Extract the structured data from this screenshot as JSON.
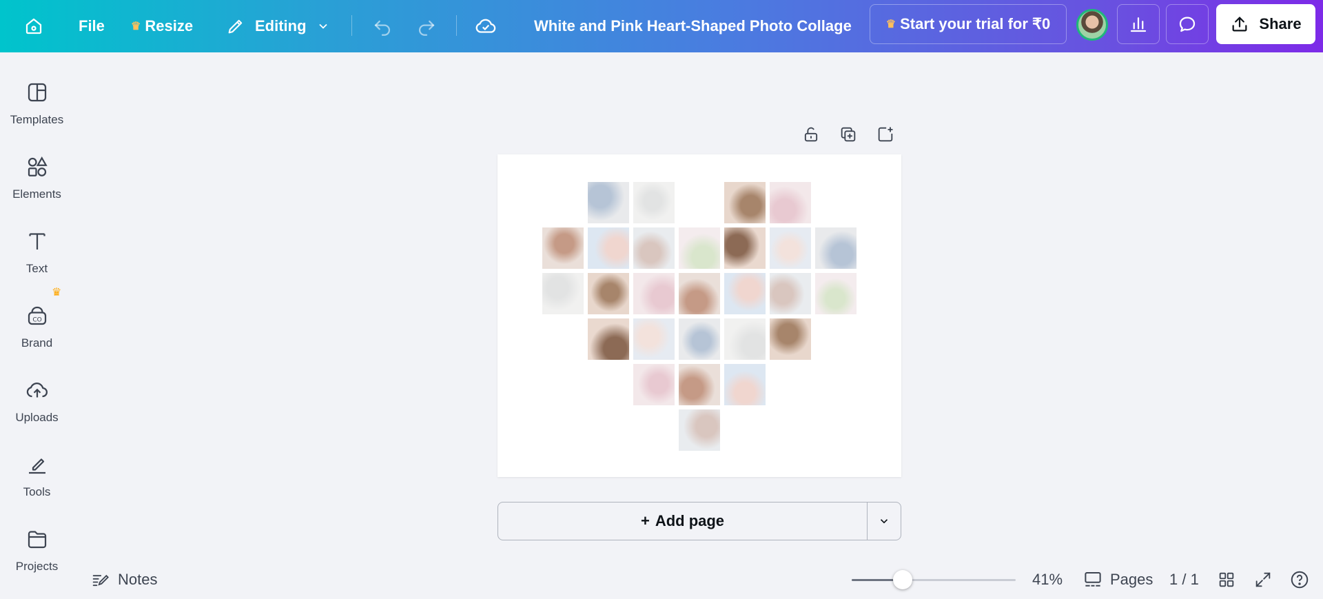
{
  "topbar": {
    "file_label": "File",
    "resize_label": "Resize",
    "editing_label": "Editing",
    "design_title": "White and Pink Heart-Shaped Photo Collage",
    "trial_label": "Start your trial for ₹0",
    "share_label": "Share",
    "crown_glyph": "♛"
  },
  "sidebar": {
    "items": [
      {
        "label": "Templates",
        "icon": "templates-icon"
      },
      {
        "label": "Elements",
        "icon": "elements-icon"
      },
      {
        "label": "Text",
        "icon": "text-icon"
      },
      {
        "label": "Brand",
        "icon": "brand-icon"
      },
      {
        "label": "Uploads",
        "icon": "uploads-icon"
      },
      {
        "label": "Tools",
        "icon": "tools-icon"
      },
      {
        "label": "Projects",
        "icon": "projects-icon"
      }
    ]
  },
  "canvas": {
    "add_page_label": "Add page",
    "add_page_plus": "+"
  },
  "bottom": {
    "notes_label": "Notes",
    "zoom_percent": 41,
    "zoom_label": "41%",
    "pages_label": "Pages",
    "page_indicator": "1 / 1"
  },
  "colors": {
    "accent": "#7d2ae8",
    "gradient_start": "#00c4cc",
    "gradient_end": "#7d2ae8",
    "crown": "#ffa600"
  }
}
